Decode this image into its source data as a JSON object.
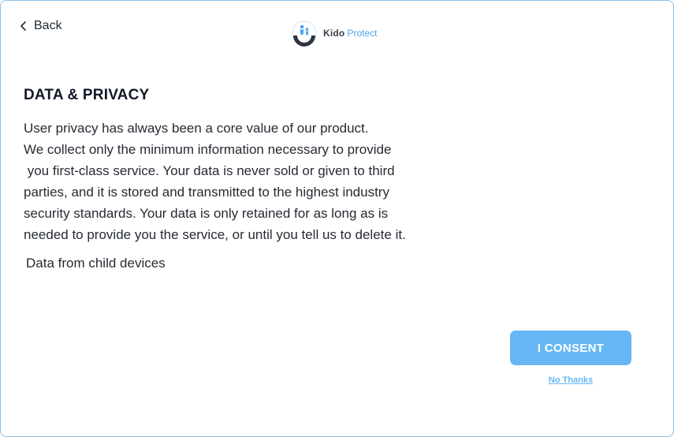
{
  "nav": {
    "back_label": "Back"
  },
  "brand": {
    "name_part1": "Kido",
    "name_part2": "Protect",
    "accent_color": "#4aa3ee"
  },
  "content": {
    "title": "DATA & PRIVACY",
    "paragraph_lines": [
      "User privacy has always been a core value of our product.",
      "We collect only the minimum information necessary to provide",
      " you first-class service. Your data is never sold or given to third",
      "parties, and it is stored and transmitted to the highest industry",
      "security standards. Your data is only retained for as long as is",
      "needed to provide you the service, or until you tell us to delete it."
    ],
    "subtext": "Data from child devices"
  },
  "actions": {
    "consent_label": "I CONSENT",
    "decline_label": "No Thanks",
    "button_color": "#66b7f3"
  },
  "icons": {
    "back": "chevron-left-icon",
    "logo": "kido-protect-logo-icon"
  }
}
